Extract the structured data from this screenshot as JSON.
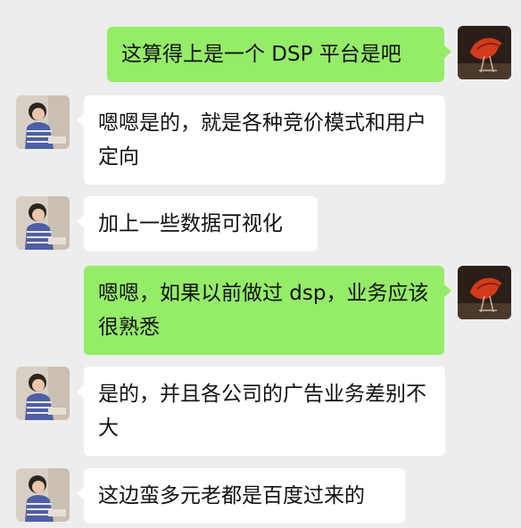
{
  "chat": {
    "messages": [
      {
        "side": "out",
        "text": "这算得上是一个 DSP 平台是吧",
        "avatar": "red-leaf-avatar-icon"
      },
      {
        "side": "in",
        "text": "嗯嗯是的，就是各种竞价模式和用户定向",
        "avatar": "child-avatar-icon"
      },
      {
        "side": "in",
        "text": "加上一些数据可视化",
        "avatar": "child-avatar-icon"
      },
      {
        "side": "out",
        "text": "嗯嗯，如果以前做过 dsp，业务应该很熟悉",
        "avatar": "red-leaf-avatar-icon"
      },
      {
        "side": "in",
        "text": "是的，并且各公司的广告业务差别不大",
        "avatar": "child-avatar-icon"
      },
      {
        "side": "in",
        "text": "这边蛮多元老都是百度过来的",
        "avatar": "child-avatar-icon"
      }
    ]
  },
  "colors": {
    "background": "#ededed",
    "bubble_incoming": "#ffffff",
    "bubble_outgoing": "#95ec69"
  }
}
